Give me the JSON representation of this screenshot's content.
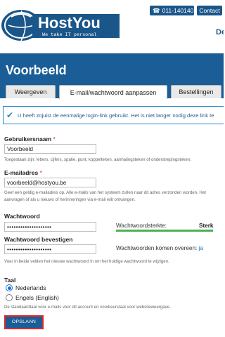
{
  "header": {
    "logo_name": "HostYou",
    "logo_tagline": "We take IT personal",
    "phone": "011-140140",
    "contact": "Contact",
    "nav_cut": "De"
  },
  "page": {
    "title": "Voorbeeld",
    "tabs": [
      {
        "label": "Weergeven"
      },
      {
        "label": "E-mail/wachtwoord aanpassen"
      },
      {
        "label": "Bestellingen"
      }
    ]
  },
  "alert": {
    "text": "U heeft zojuist de eenmalige login-link gebruikt. Het is niet langer nodig deze link te"
  },
  "form": {
    "username": {
      "label": "Gebruikersnaam",
      "required": "*",
      "value": "Voorbeeld",
      "help": "Toegestaan zijn: letters, cijfers, spatie, punt, koppelteken, aanhalingsteken of onderstrepingsteken."
    },
    "email": {
      "label": "E-mailadres",
      "required": "*",
      "value": "voorbeeld@hostyou.be",
      "help_line1": "Geef een geldig e-mailadres op. Alle e-mails van het systeem zullen naar dit adres verzonden worden. Het",
      "help_line2": "aanvragen of als u nieuws of herinneringen via e-mail wilt ontvangen."
    },
    "password": {
      "label": "Wachtwoord",
      "value": "••••••••••••••••••••",
      "strength_label": "Wachtwoordsterkte:",
      "strength_value": "Sterk",
      "strength_color": "#4caf50"
    },
    "password_confirm": {
      "label": "Wachtwoord bevestigen",
      "value": "••••••••••••••••••••",
      "match_label": "Wachtwoorden komen overeen:",
      "match_value": "ja"
    },
    "password_help": "Voer in beide velden het nieuwe wachtwoord in om het huidige wachtwoord te wijzigen.",
    "language": {
      "label": "Taal",
      "options": [
        {
          "label": "Nederlands",
          "selected": true
        },
        {
          "label": "Engels (English)",
          "selected": false
        }
      ],
      "help": "De standaardtaal voor e-mails voor dit account en voorkeurstaal voor websiteweergave."
    },
    "submit": "OPSLAAN"
  },
  "colors": {
    "brand_blue": "#1b5d96",
    "header_button": "#1a568a",
    "alert_blue": "#2a88c8",
    "submit_border": "#e0262e",
    "required_red": "#c62828"
  }
}
